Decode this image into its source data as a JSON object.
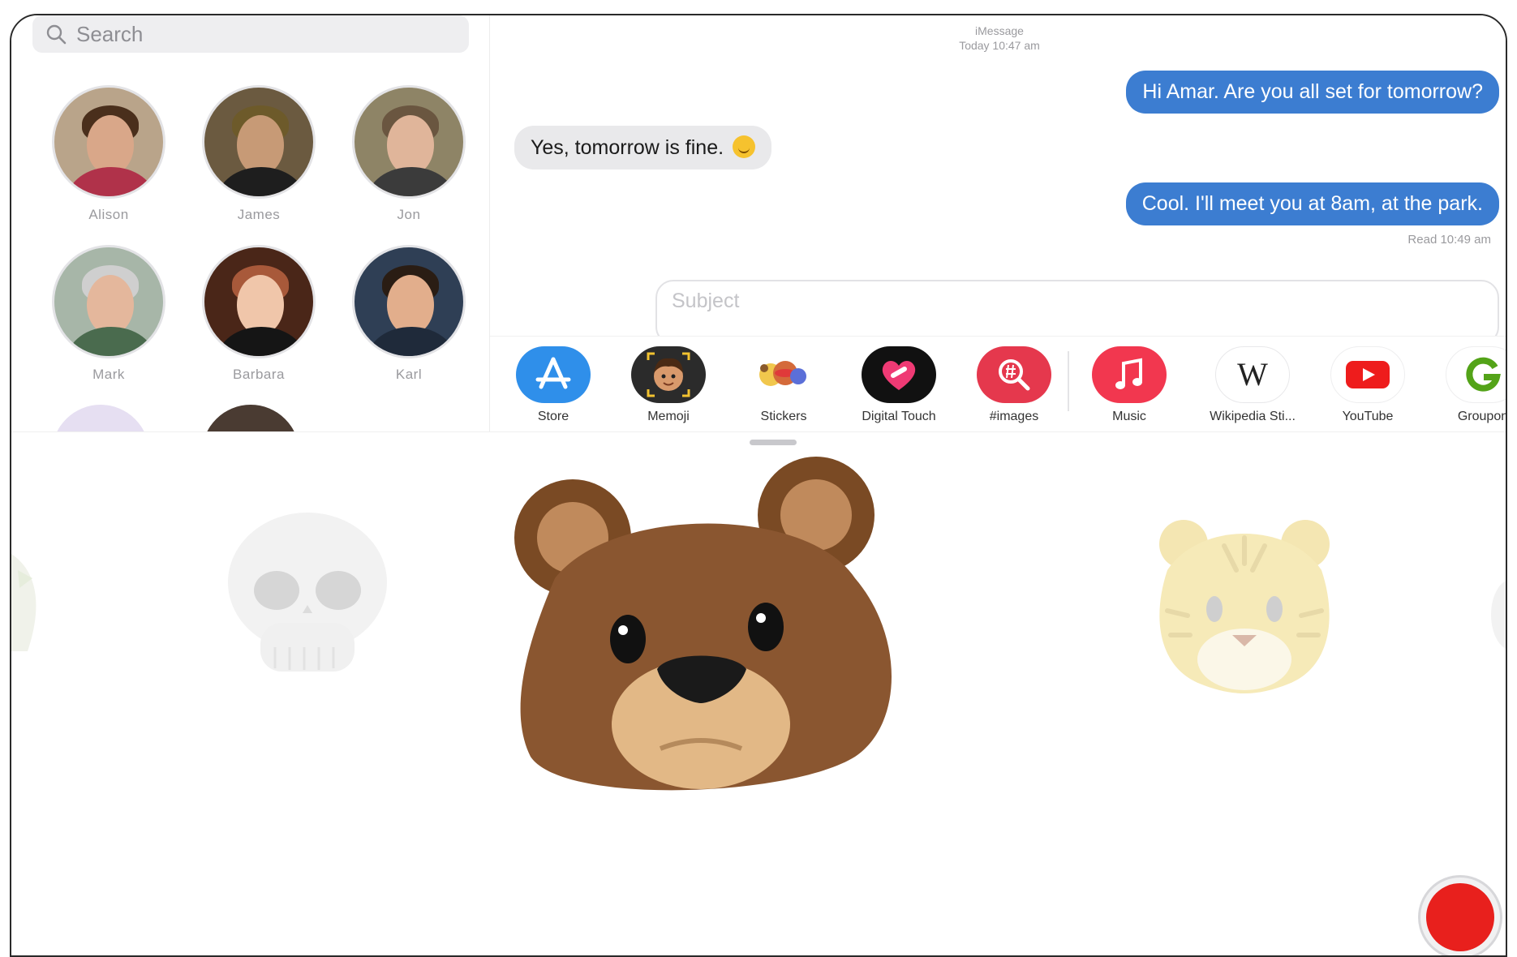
{
  "search": {
    "placeholder": "Search"
  },
  "contacts": [
    {
      "name": "Alison"
    },
    {
      "name": "James"
    },
    {
      "name": "Jon"
    },
    {
      "name": "Mark"
    },
    {
      "name": "Barbara"
    },
    {
      "name": "Karl"
    }
  ],
  "conversation": {
    "service": "iMessage",
    "timestamp": "Today 10:47 am",
    "messages": [
      {
        "direction": "outgoing",
        "text": "Hi Amar. Are you all set for tomorrow?"
      },
      {
        "direction": "incoming",
        "text": "Yes, tomorrow is fine.",
        "emoji": "smiling-face"
      },
      {
        "direction": "outgoing",
        "text": "Cool. I'll meet you at 8am, at the park."
      }
    ],
    "read_receipt": "Read 10:49 am",
    "subject_placeholder": "Subject"
  },
  "apps": [
    {
      "label": "Store",
      "icon": "app-store-icon",
      "color": "#2f8fea"
    },
    {
      "label": "Memoji",
      "icon": "memoji-icon",
      "color": "#2b2b2b"
    },
    {
      "label": "Stickers",
      "icon": "stickers-icon",
      "color": "#ffffff"
    },
    {
      "label": "Digital Touch",
      "icon": "digital-touch-icon",
      "color": "#111111"
    },
    {
      "label": "#images",
      "icon": "images-search-icon",
      "color": "#e5384d"
    },
    {
      "label": "Music",
      "icon": "music-icon",
      "color": "#f2374f"
    },
    {
      "label": "Wikipedia Sti...",
      "icon": "wikipedia-icon",
      "color": "#ffffff"
    },
    {
      "label": "YouTube",
      "icon": "youtube-icon",
      "color": "#ffffff"
    },
    {
      "label": "Groupon",
      "icon": "groupon-icon",
      "color": "#ffffff"
    }
  ],
  "animoji": {
    "characters": [
      "unicorn",
      "skull",
      "bear",
      "tiger"
    ],
    "selected": "bear"
  },
  "colors": {
    "outgoing_bubble": "#3c7dd1",
    "incoming_bubble": "#e9e9eb",
    "record": "#e8201d"
  }
}
